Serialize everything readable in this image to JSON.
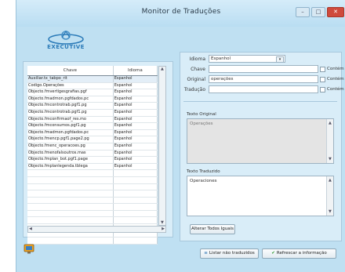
{
  "window": {
    "title": "Monitor de Traduções"
  },
  "logo": {
    "text": "EXECUTIVE"
  },
  "grid": {
    "columns": [
      "Chave",
      "Idioma"
    ],
    "rows": [
      [
        "Auxiliar.tx_tabpo_rit",
        "Espanhol"
      ],
      [
        "Codigo.Operações",
        "Espanhol"
      ],
      [
        "Objecto.fmvertigesgrafias.pgf",
        "Espanhol"
      ],
      [
        "Objecto.fmadmon.pgfdados.pc",
        "Espanhol"
      ],
      [
        "Objecto.fmcontrotrab.pgf1.pg",
        "Espanhol"
      ],
      [
        "Objecto.fmcontrotrab.pgf1.pg",
        "Espanhol"
      ],
      [
        "Objecto.fmconfirmaof_res.mo",
        "Espanhol"
      ],
      [
        "Objecto.fmconsumos.pgf1.pg",
        "Espanhol"
      ],
      [
        "Objecto.fmadmon.pgfdados.pc",
        "Espanhol"
      ],
      [
        "Objecto.fmencp.pgf1.page2.pg",
        "Espanhol"
      ],
      [
        "Objecto.fmenc_operacoes.pg",
        "Espanhol"
      ],
      [
        "Objecto.fmenofalsoutros.mas",
        "Espanhol"
      ],
      [
        "Objecto.fmplan_bot.pgf1.page",
        "Espanhol"
      ],
      [
        "Objecto.fmplanlegenda.tblega",
        "Espanhol"
      ]
    ]
  },
  "form": {
    "idioma_label": "Idioma",
    "idioma_value": "Espanhol",
    "chave_label": "Chave",
    "chave_value": "",
    "original_label": "Original",
    "original_value": "operações",
    "traducao_label": "Tradução",
    "traducao_value": "",
    "contem_label": "Contém"
  },
  "texto_original": {
    "label": "Texto Original",
    "value": "Operações"
  },
  "texto_traduzido": {
    "label": "Texto Traduzido",
    "value": "Operaciones"
  },
  "buttons": {
    "alterar_todos": "Alterar Todos Iguais",
    "listar_nao_traduzidos": "Listar não traduzidos",
    "refrescar": "Refrescar a informação"
  }
}
